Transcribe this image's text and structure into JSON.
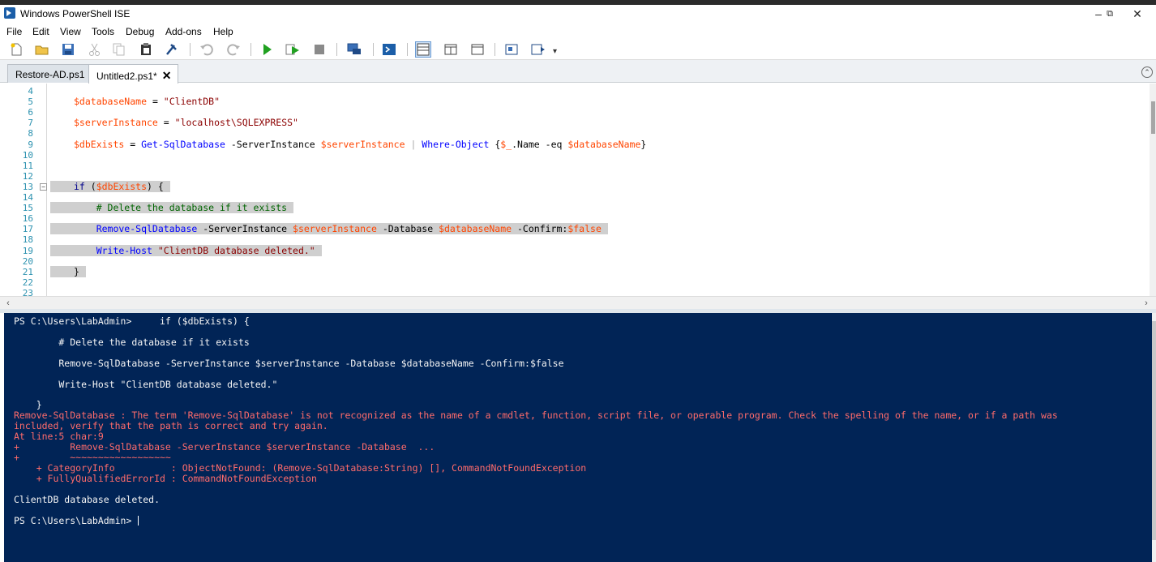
{
  "window": {
    "title": "Windows PowerShell ISE"
  },
  "menu": [
    "File",
    "Edit",
    "View",
    "Tools",
    "Debug",
    "Add-ons",
    "Help"
  ],
  "toolbar_icons": [
    "new-icon",
    "open-icon",
    "save-icon",
    "cut-icon",
    "copy-icon",
    "paste-icon",
    "clear-icon",
    "undo-icon",
    "redo-icon",
    "run-icon",
    "run-selection-icon",
    "stop-icon",
    "remote-icon",
    "powershell-icon",
    "layout-top-icon",
    "layout-right-icon",
    "layout-max-icon",
    "show-commands-icon",
    "addon-icon",
    "customize-icon"
  ],
  "tabs": [
    {
      "label": "Restore-AD.ps1",
      "active": false
    },
    {
      "label": "Untitled2.ps1*",
      "active": true,
      "close": "✕"
    }
  ],
  "editor": {
    "line_numbers": [
      "4",
      "5",
      "6",
      "7",
      "8",
      "9",
      "10",
      "11",
      "12",
      "13",
      "14",
      "15",
      "16",
      "17",
      "18",
      "19",
      "20",
      "21",
      "22",
      "23"
    ],
    "lines": [
      {
        "n": "5",
        "parts": [
          [
            "var",
            "$databaseName"
          ],
          [
            "par",
            " = "
          ],
          [
            "str",
            "\"ClientDB\""
          ]
        ]
      },
      {
        "n": "7",
        "parts": [
          [
            "var",
            "$serverInstance"
          ],
          [
            "par",
            " = "
          ],
          [
            "str",
            "\"localhost\\SQLEXPRESS\""
          ]
        ]
      },
      {
        "n": "9",
        "parts": [
          [
            "var",
            "$dbExists"
          ],
          [
            "par",
            " = "
          ],
          [
            "cmd",
            "Get-SqlDatabase"
          ],
          [
            "par",
            " -ServerInstance "
          ],
          [
            "var",
            "$serverInstance"
          ],
          [
            "op",
            " | "
          ],
          [
            "cmd",
            "Where-Object"
          ],
          [
            "par",
            " {"
          ],
          [
            "var",
            "$_"
          ],
          [
            "par",
            ".Name -eq "
          ],
          [
            "var",
            "$databaseName"
          ],
          [
            "par",
            "}"
          ]
        ]
      },
      {
        "n": "13",
        "hl": true,
        "parts": [
          [
            "kw",
            "if"
          ],
          [
            "par",
            " ("
          ],
          [
            "var",
            "$dbExists"
          ],
          [
            "par",
            ") {"
          ]
        ]
      },
      {
        "n": "15",
        "hl": true,
        "parts": [
          [
            "cmt",
            "    # Delete the database if it exists"
          ]
        ]
      },
      {
        "n": "17",
        "hl": true,
        "parts": [
          [
            "cmd",
            "    Remove-SqlDatabase"
          ],
          [
            "par",
            " -ServerInstance "
          ],
          [
            "var",
            "$serverInstance"
          ],
          [
            "par",
            " -Database "
          ],
          [
            "var",
            "$databaseName"
          ],
          [
            "par",
            " -Confirm:"
          ],
          [
            "var",
            "$false"
          ]
        ]
      },
      {
        "n": "19",
        "hl": true,
        "parts": [
          [
            "cmd",
            "    Write-Host"
          ],
          [
            "par",
            " "
          ],
          [
            "str",
            "\"ClientDB database deleted.\""
          ]
        ]
      },
      {
        "n": "21",
        "hl": true,
        "parts": [
          [
            "par",
            "}"
          ]
        ]
      }
    ]
  },
  "console": {
    "lines": [
      {
        "t": "PS C:\\Users\\LabAdmin>     if ($dbExists) {",
        "err": false
      },
      {
        "t": "        # Delete the database if it exists",
        "err": false
      },
      {
        "t": "        Remove-SqlDatabase -ServerInstance $serverInstance -Database $databaseName -Confirm:$false",
        "err": false
      },
      {
        "t": "        Write-Host \"ClientDB database deleted.\"",
        "err": false
      },
      {
        "t": "    }",
        "err": false
      },
      {
        "t": "Remove-SqlDatabase : The term 'Remove-SqlDatabase' is not recognized as the name of a cmdlet, function, script file, or operable program. Check the spelling of the name, or if a path was",
        "err": true
      },
      {
        "t": "included, verify that the path is correct and try again.",
        "err": true
      },
      {
        "t": "At line:5 char:9",
        "err": true
      },
      {
        "t": "+         Remove-SqlDatabase -ServerInstance $serverInstance -Database  ...",
        "err": true
      },
      {
        "t": "+         ~~~~~~~~~~~~~~~~~~",
        "err": true
      },
      {
        "t": "    + CategoryInfo          : ObjectNotFound: (Remove-SqlDatabase:String) [], CommandNotFoundException",
        "err": true
      },
      {
        "t": "    + FullyQualifiedErrorId : CommandNotFoundException",
        "err": true
      },
      {
        "t": "ClientDB database deleted.",
        "err": false
      },
      {
        "t": "PS C:\\Users\\LabAdmin> ",
        "err": false,
        "cursor": true
      }
    ]
  }
}
